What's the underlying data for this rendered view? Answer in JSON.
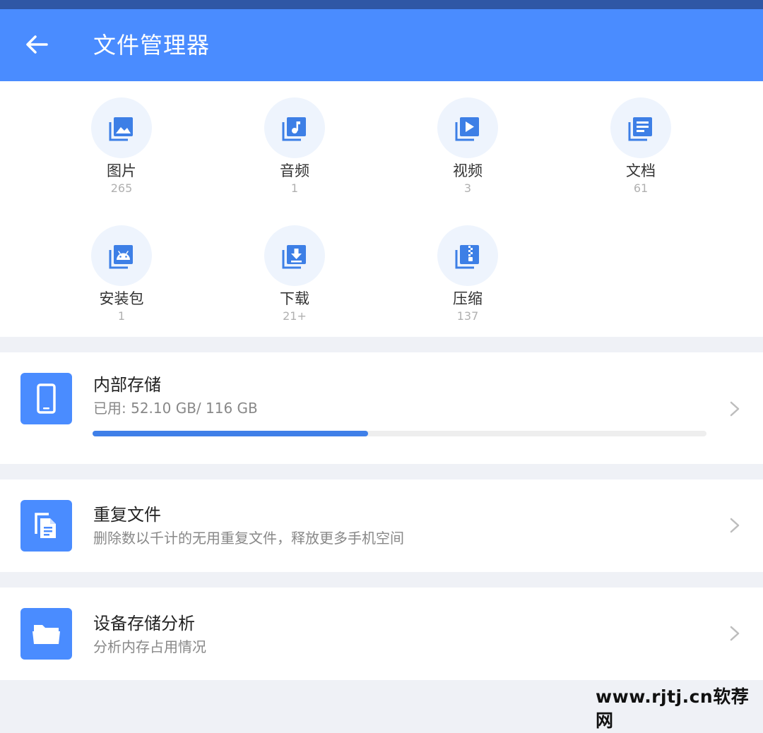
{
  "app_bar": {
    "title": "文件管理器",
    "back_icon": "arrow-left-icon",
    "color": "#4a8cff"
  },
  "categories": [
    {
      "label": "图片",
      "count": "265",
      "icon": "image-icon"
    },
    {
      "label": "音频",
      "count": "1",
      "icon": "music-note-icon"
    },
    {
      "label": "视频",
      "count": "3",
      "icon": "play-video-icon"
    },
    {
      "label": "文档",
      "count": "61",
      "icon": "document-icon"
    },
    {
      "label": "安装包",
      "count": "1",
      "icon": "android-icon"
    },
    {
      "label": "下载",
      "count": "21+",
      "icon": "download-icon"
    },
    {
      "label": "压缩",
      "count": "137",
      "icon": "zip-icon"
    }
  ],
  "storage": {
    "title": "内部存储",
    "usage_text": "已用: 52.10 GB/ 116 GB",
    "used_fraction": 0.4491,
    "icon": "phone-icon"
  },
  "duplicates": {
    "title": "重复文件",
    "subtitle": "删除数以千计的无用重复文件，释放更多手机空间",
    "icon": "duplicate-files-icon"
  },
  "analysis": {
    "title": "设备存储分析",
    "subtitle": "分析内存占用情况",
    "icon": "folder-open-icon"
  },
  "watermark": "www.rjtj.cn软荐网",
  "colors": {
    "accent": "#4a8cff",
    "status_bar": "#2f57a5",
    "progress": "#3f7fe8",
    "icon_circle": "#eef4fd"
  }
}
